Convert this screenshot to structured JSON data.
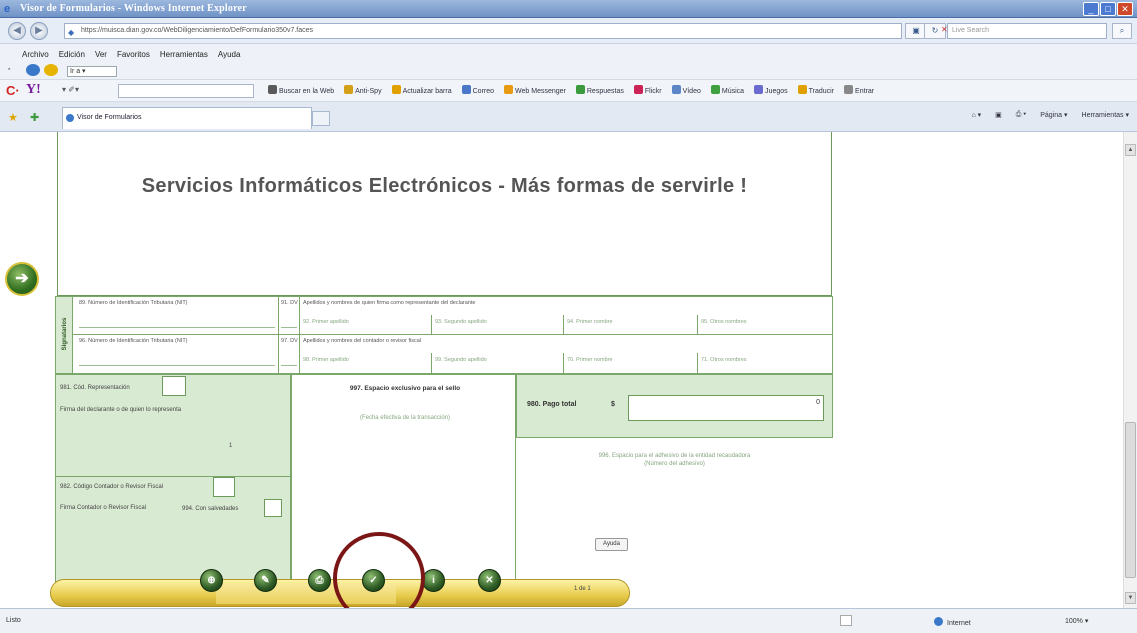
{
  "window": {
    "title": "Visor de Formularios - Windows Internet Explorer",
    "url": "https://muisca.dian.gov.co/WebDiligenciamiento/DefFormulario350v7.faces",
    "search_placeholder": "Live Search",
    "controls": [
      "_",
      "□",
      "✕"
    ]
  },
  "menu": {
    "items": [
      "Archivo",
      "Edición",
      "Ver",
      "Favoritos",
      "Herramientas",
      "Ayuda"
    ],
    "mini_input": "Ir a ▾"
  },
  "yahoo_toolbar": {
    "logo": "Y!",
    "items": [
      {
        "label": "Buscar en la Web",
        "color": "#5a5a5a"
      },
      {
        "label": "Anti-Spy",
        "color": "#d4a017"
      },
      {
        "label": "Actualizar barra",
        "color": "#e0a000"
      },
      {
        "label": "Correo",
        "color": "#4b77c9"
      },
      {
        "label": "Web Messenger",
        "color": "#e89b12"
      },
      {
        "label": "Respuestas",
        "color": "#3b9a3b"
      },
      {
        "label": "Flickr",
        "color": "#cc2255"
      },
      {
        "label": "Vídeo",
        "color": "#5a86c8"
      },
      {
        "label": "Música",
        "color": "#3fa03f"
      },
      {
        "label": "Juegos",
        "color": "#6a6ad0"
      },
      {
        "label": "Traducir",
        "color": "#e0a000"
      },
      {
        "label": "Entrar",
        "color": "#888888"
      }
    ]
  },
  "tabs": {
    "active": "Visor de Formularios",
    "tools": [
      "Página ▾",
      "Herramientas ▾"
    ]
  },
  "form": {
    "banner": "Servicios Informáticos Electrónicos  -  Más formas de servirle !",
    "signatories_label": "Signatarios",
    "row1": {
      "nit_label": "89. Número de Identificación Tributaria (NIT)",
      "dv_label": "91. DV",
      "name_label": "Apellidos y nombres de quien firma como representante del declarante",
      "sub": [
        "92. Primer apellido",
        "93. Segundo apellido",
        "94. Primer nombre",
        "95. Otros nombres"
      ]
    },
    "row2": {
      "nit_label": "96. Número de Identificación Tributaria (NIT)",
      "dv_label": "97. DV",
      "name_label": "Apellidos y nombres del contador o revisor fiscal",
      "sub": [
        "98. Primer apellido",
        "99. Segundo apellido",
        "70. Primer nombre",
        "71. Otros nombres"
      ]
    },
    "left": {
      "rep_code": "981. Cód. Representación",
      "rep_sign": "Firma del declarante o de quien lo representa",
      "one": "1",
      "contador_code": "982. Código Contador o Revisor Fiscal",
      "contador_sign": "Firma Contador o Revisor Fiscal",
      "salvedades": "994. Con salvedades"
    },
    "middle": {
      "title": "997. Espacio exclusivo para el sello",
      "subtitle": "(Fecha efectiva de la transacción)"
    },
    "right": {
      "pago_label": "980. Pago total",
      "currency": "$",
      "pago_value": "0",
      "adhesivo": "996. Espacio para el adhesivo de la entidad recaudadora\n(Número del adhesivo)"
    },
    "help_button": "Ayuda",
    "page_counter": "1 de 1"
  },
  "bottom_toolbar": {
    "buttons": [
      {
        "name": "save-icon",
        "glyph": "⊕"
      },
      {
        "name": "edit-icon",
        "glyph": "✎"
      },
      {
        "name": "print-icon",
        "glyph": "⎙"
      },
      {
        "name": "sign-icon",
        "glyph": "✓"
      },
      {
        "name": "info-icon",
        "glyph": "i"
      },
      {
        "name": "close-icon",
        "glyph": "✕"
      }
    ]
  },
  "statusbar": {
    "status": "Listo",
    "zone": "Internet",
    "zoom": "100%  ▾"
  }
}
